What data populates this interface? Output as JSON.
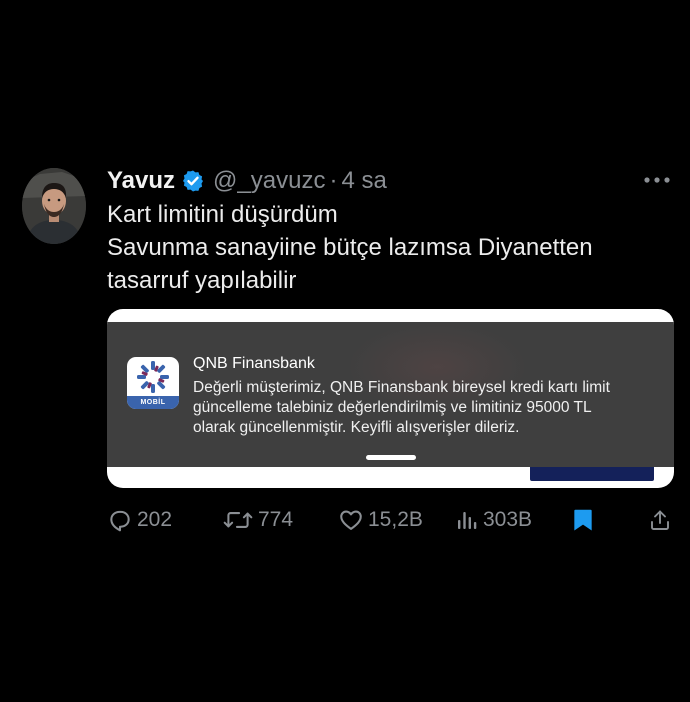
{
  "tweet": {
    "author_name": "Yavuz",
    "handle": "@_yavuzc",
    "separator": "·",
    "time": "4 sa",
    "text_lines": [
      "Kart limitini düşürdüm",
      "Savunma sanayiine bütçe lazımsa Diyanetten",
      "tasarruf yapılabilir"
    ]
  },
  "notification": {
    "app_name": "QNB Finansbank",
    "app_icon_label": "MOBİL",
    "body_lines": [
      "Değerli müşterimiz, QNB Finansbank bireysel kredi kartı limit",
      "güncelleme talebiniz değerlendirilmiş ve limitiniz 95000 TL",
      "olarak güncellenmiştir. Keyifli alışverişler dileriz."
    ]
  },
  "actions": {
    "replies": "202",
    "reposts": "774",
    "likes": "15,2B",
    "views": "303B"
  },
  "colors": {
    "background": "#000000",
    "verified": "#1d9bf0",
    "bookmark": "#1d9bf0",
    "muted_text": "#8b8f94",
    "notification_bg": "#3f3f3f"
  },
  "icons": {
    "verified": "verified-badge-icon",
    "more": "more-options-icon",
    "reply": "reply-icon",
    "repost": "repost-icon",
    "like": "heart-icon",
    "views": "views-chart-icon",
    "bookmark": "bookmark-icon",
    "share": "share-icon"
  }
}
